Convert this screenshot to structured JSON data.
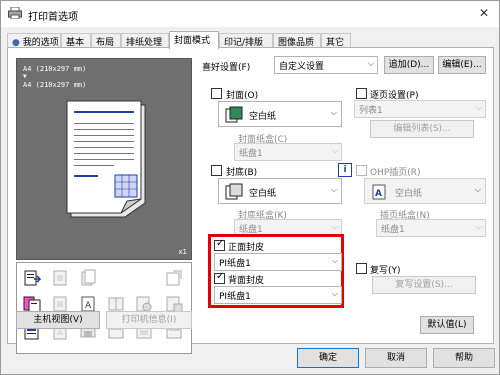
{
  "window": {
    "title": "打印首选项"
  },
  "tabs": [
    "我的选项",
    "基本",
    "布局",
    "排纸处理",
    "封面模式",
    "印记/排版",
    "图像品质",
    "其它"
  ],
  "preview": {
    "line1": "A4 (210x297 mm)",
    "line2": "A4 (210x297 mm)",
    "zoom": "x1"
  },
  "left_buttons": {
    "main_view": "主机视图(V)",
    "printer_info": "打印机信息(I)"
  },
  "favorites": {
    "label": "喜好设置(F)",
    "value": "自定义设置",
    "add": "追加(D)...",
    "edit": "编辑(E)..."
  },
  "front_cover": {
    "label": "封面(O)",
    "paper": "空白纸",
    "tray_label": "封面纸盒(C)",
    "tray_value": "纸盘1"
  },
  "back_cover": {
    "label": "封底(B)",
    "paper": "空白纸",
    "tray_label": "封底纸盒(K)",
    "tray_value": "纸盘1"
  },
  "front_sheet": {
    "label": "正面封皮",
    "value": "PI纸盘1"
  },
  "back_sheet": {
    "label": "背面封皮",
    "value": "PI纸盘1"
  },
  "tab_setting": {
    "label": "逐页设置(P)",
    "value": "列表1",
    "edit_list": "编辑列表(S)..."
  },
  "ohp": {
    "label": "OHP插页(R)",
    "paper": "空白纸",
    "tray_label": "插页纸盒(N)",
    "tray_value": "纸盘1"
  },
  "copy": {
    "label": "复写(Y)",
    "settings": "复写设置(S)..."
  },
  "default_button": "默认值(L)",
  "footer": {
    "ok": "确定",
    "cancel": "取消",
    "help": "帮助"
  },
  "colors": {
    "highlight_border": "#e00000",
    "preview_bg": "#6f6f6f",
    "accent_blue": "#1e3fa8"
  }
}
